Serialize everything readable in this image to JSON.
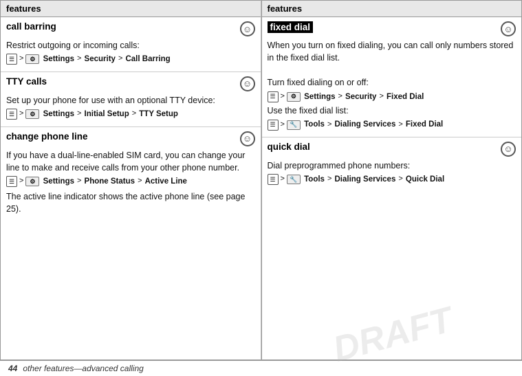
{
  "page": {
    "footer_page_num": "44",
    "footer_text": "other features—advanced calling",
    "watermark": "DRAFT"
  },
  "columns": {
    "header_label": "features"
  },
  "left": {
    "sections": [
      {
        "id": "call-barring",
        "title": "call barring",
        "highlight": false,
        "has_accessibility": true,
        "body_lines": [
          "Restrict outgoing or incoming calls:"
        ],
        "nav_items": [
          {
            "id": "nav1",
            "parts": [
              "menu",
              ">",
              "settings",
              "Settings",
              ">",
              "Security",
              ">",
              "Call Barring"
            ]
          }
        ]
      },
      {
        "id": "tty-calls",
        "title": "TTY calls",
        "highlight": false,
        "has_accessibility": true,
        "body_lines": [
          "Set up your phone for use with an optional TTY device:"
        ],
        "nav_items": [
          {
            "id": "nav2",
            "parts": [
              "menu",
              ">",
              "settings",
              "Settings",
              ">",
              "Initial Setup",
              ">",
              "TTY Setup"
            ]
          }
        ]
      },
      {
        "id": "change-phone-line",
        "title": "change phone line",
        "highlight": false,
        "has_accessibility": true,
        "body_lines": [
          "If you have a dual-line-enabled SIM card, you can change your line to make and receive calls from your other phone number."
        ],
        "nav_items": [
          {
            "id": "nav3",
            "parts": [
              "menu",
              ">",
              "settings",
              "Settings",
              ">",
              "Phone Status",
              ">",
              "Active Line"
            ]
          }
        ],
        "extra_text": "The active line indicator shows the active phone line (see page 25)."
      }
    ]
  },
  "right": {
    "sections": [
      {
        "id": "fixed-dial",
        "title": "fixed dial",
        "highlight": true,
        "has_accessibility": true,
        "body_lines": [
          "When you turn on fixed dialing, you can call only numbers stored in the fixed dial list.",
          "Turn fixed dialing on or off:"
        ],
        "nav_items": [
          {
            "id": "nav4",
            "parts": [
              "menu",
              ">",
              "settings",
              "Settings",
              ">",
              "Security",
              ">",
              "Fixed Dial"
            ]
          }
        ],
        "extra_text": "Use the fixed dial list:",
        "nav_items2": [
          {
            "id": "nav5",
            "parts": [
              "menu",
              ">",
              "tools",
              "Tools",
              ">",
              "Dialing Services",
              ">",
              "Fixed Dial"
            ]
          }
        ]
      },
      {
        "id": "quick-dial",
        "title": "quick dial",
        "highlight": false,
        "has_accessibility": true,
        "body_lines": [
          "Dial preprogrammed phone numbers:"
        ],
        "nav_items": [
          {
            "id": "nav6",
            "parts": [
              "menu",
              ">",
              "tools",
              "Tools",
              ">",
              "Dialing Services",
              ">",
              "Quick Dial"
            ]
          }
        ]
      }
    ]
  }
}
